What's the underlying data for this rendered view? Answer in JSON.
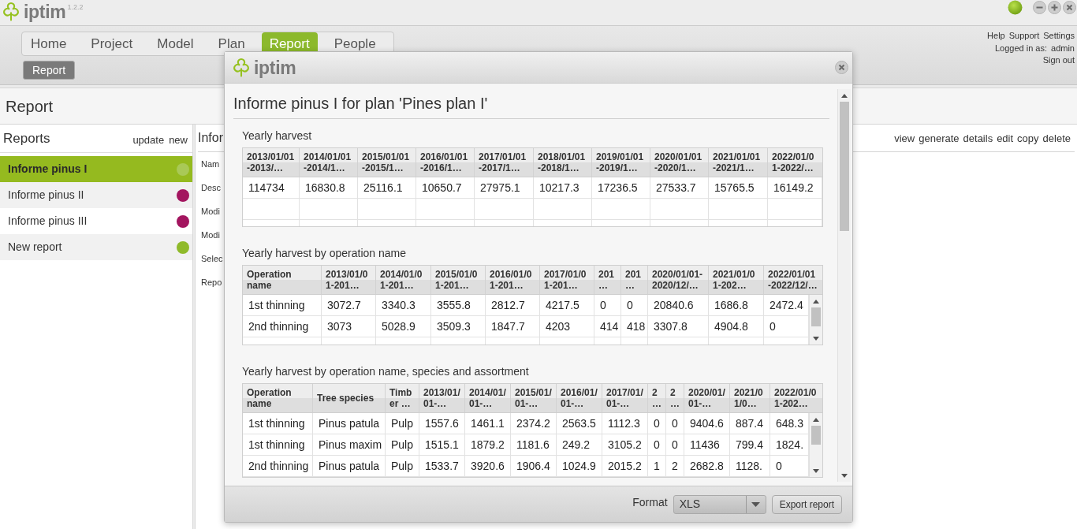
{
  "header": {
    "logo": "iptim",
    "version": "1.2.2"
  },
  "nav": {
    "tabs": [
      {
        "label": "Home",
        "selected": false
      },
      {
        "label": "Project",
        "selected": false
      },
      {
        "label": "Model",
        "selected": false
      },
      {
        "label": "Plan",
        "selected": false
      },
      {
        "label": "Report",
        "selected": true
      },
      {
        "label": "People",
        "selected": false
      }
    ],
    "subtabs": [
      {
        "label": "Report",
        "selected": true
      }
    ]
  },
  "user_menu": {
    "links": [
      "Help",
      "Support",
      "Settings"
    ],
    "logged_in_label": "Logged in as:",
    "username": "admin",
    "sign_out": "Sign out"
  },
  "page_title": "Report",
  "reports_panel": {
    "title": "Reports",
    "actions": [
      "update",
      "new"
    ],
    "items": [
      {
        "label": "Informe pinus I",
        "selected": true,
        "color": "#a9c957"
      },
      {
        "label": "Informe pinus II",
        "selected": false,
        "color": "#a3155f"
      },
      {
        "label": "Informe pinus III",
        "selected": false,
        "color": "#a3155f"
      },
      {
        "label": "New report",
        "selected": false,
        "color": "#8fba2a"
      }
    ]
  },
  "details_panel": {
    "title": "Infor",
    "actions": [
      "view",
      "generate",
      "details",
      "edit",
      "copy",
      "delete"
    ],
    "field_labels": [
      "Nam",
      "Desc",
      "Modi",
      "Modi",
      "Selec",
      "Repo"
    ]
  },
  "dialog": {
    "logo": "iptim",
    "title": "Informe pinus I for plan 'Pines plan I'",
    "sections": [
      {
        "title": "Yearly harvest",
        "columns": [
          "2013/01/01-2013/…",
          "2014/01/01-2014/1…",
          "2015/01/01-2015/1…",
          "2016/01/01-2016/1…",
          "2017/01/01-2017/1…",
          "2018/01/01-2018/1…",
          "2019/01/01-2019/1…",
          "2020/01/01-2020/1…",
          "2021/01/01-2021/1…",
          "2022/01/01-2022/…"
        ],
        "rows": [
          [
            "114734",
            "16830.8",
            "25116.1",
            "10650.7",
            "27975.1",
            "10217.3",
            "17236.5",
            "27533.7",
            "15765.5",
            "16149.2"
          ]
        ]
      },
      {
        "title": "Yearly harvest by operation name",
        "columns": [
          "Operation name",
          "2013/01/01-201…",
          "2014/01/01-201…",
          "2015/01/01-201…",
          "2016/01/01-201…",
          "2017/01/01-201…",
          "201…",
          "201…",
          "2020/01/01-2020/12/…",
          "2021/01/01-202…",
          "2022/01/01-2022/12/…"
        ],
        "rows": [
          [
            "1st thinning",
            "3072.7",
            "3340.3",
            "3555.8",
            "2812.7",
            "4217.5",
            "0",
            "0",
            "20840.6",
            "1686.8",
            "2472.4"
          ],
          [
            "2nd thinning",
            "3073",
            "5028.9",
            "3509.3",
            "1847.7",
            "4203",
            "414",
            "418",
            "3307.8",
            "4904.8",
            "0"
          ]
        ]
      },
      {
        "title": "Yearly harvest by operation name, species and assortment",
        "columns": [
          "Operation name",
          "Tree species",
          "Timber …",
          "2013/01/01-…",
          "2014/01/01-…",
          "2015/01/01-…",
          "2016/01/01-…",
          "2017/01/01-…",
          "2…",
          "2…",
          "2020/01/01-…",
          "2021/01/0…",
          "2022/01/01-202…"
        ],
        "rows": [
          [
            "1st thinning",
            "Pinus patula",
            "Pulp",
            "1557.6",
            "1461.1",
            "2374.2",
            "2563.5",
            "1112.3",
            "0",
            "0",
            "9404.6",
            "887.4",
            "648.3"
          ],
          [
            "1st thinning",
            "Pinus maxim",
            "Pulp",
            "1515.1",
            "1879.2",
            "1181.6",
            "249.2",
            "3105.2",
            "0",
            "0",
            "11436",
            "799.4",
            "1824."
          ],
          [
            "2nd thinning",
            "Pinus patula",
            "Pulp",
            "1533.7",
            "3920.6",
            "1906.4",
            "1024.9",
            "2015.2",
            "1",
            "2",
            "2682.8",
            "1128.",
            "0"
          ]
        ]
      }
    ],
    "format_label": "Format",
    "format_value": "XLS",
    "export_button": "Export report"
  }
}
